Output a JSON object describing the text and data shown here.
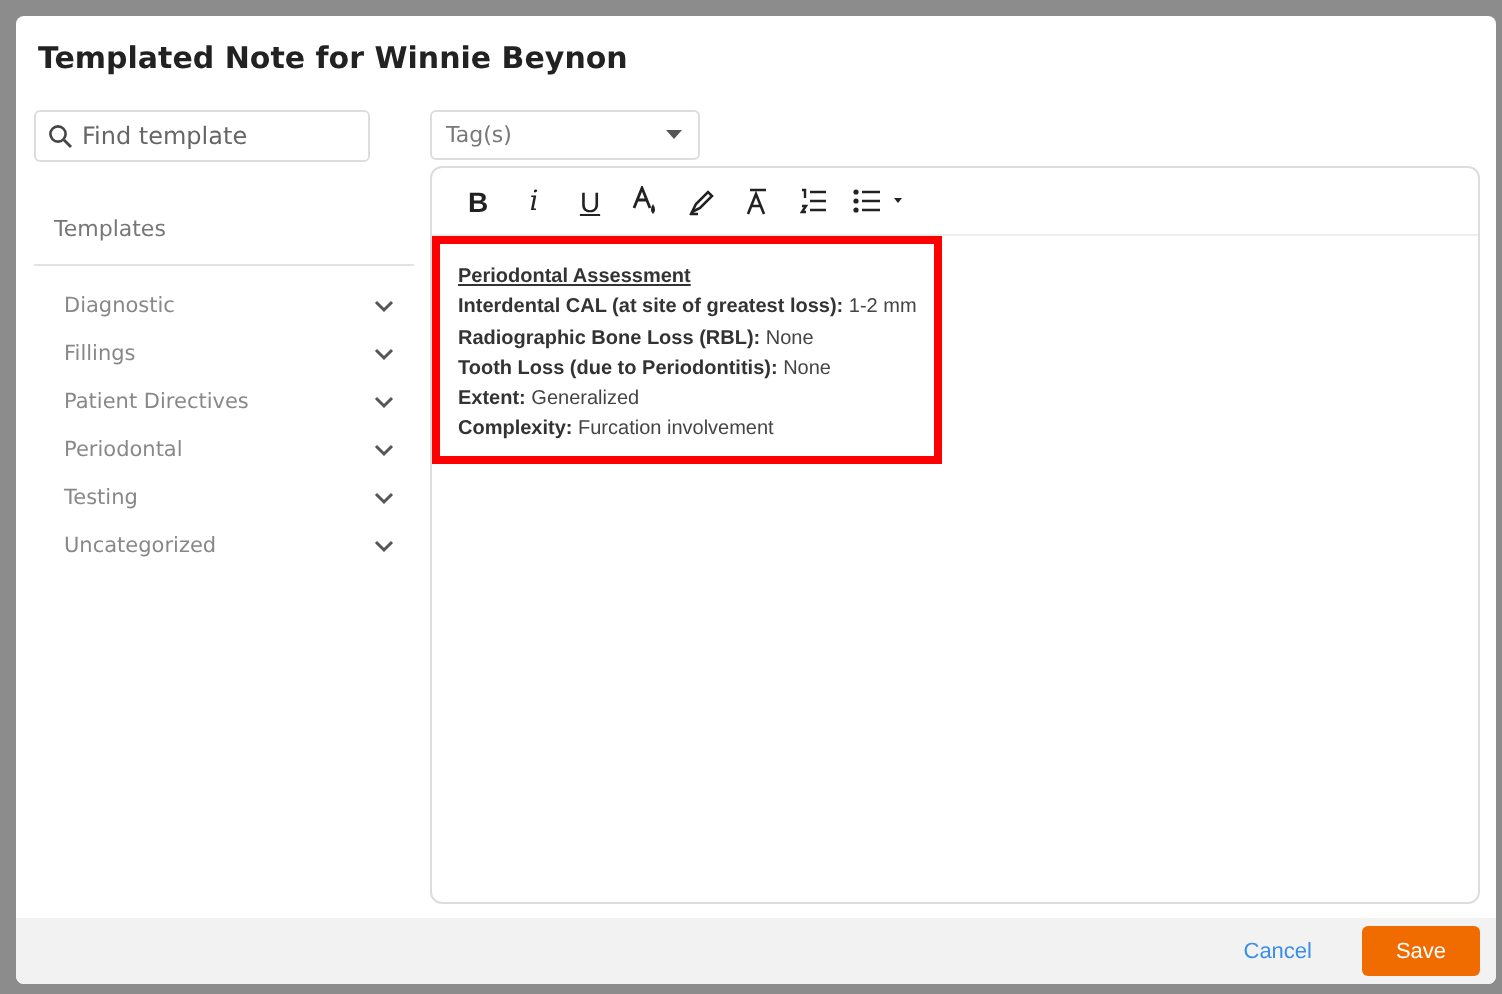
{
  "dialog": {
    "title": "Templated Note for Winnie Beynon"
  },
  "search": {
    "placeholder": "Find template"
  },
  "templates": {
    "heading": "Templates",
    "items": [
      {
        "label": "Diagnostic",
        "expanded": false
      },
      {
        "label": "Fillings",
        "expanded": false
      },
      {
        "label": "Patient Directives",
        "expanded": false
      },
      {
        "label": "Periodontal",
        "expanded": false
      },
      {
        "label": "Testing",
        "expanded": false
      },
      {
        "label": "Uncategorized",
        "expanded": false
      }
    ]
  },
  "tags": {
    "placeholder": "Tag(s)"
  },
  "toolbar": [
    {
      "kind": "bold",
      "label": "B"
    },
    {
      "kind": "italic",
      "label": "i"
    },
    {
      "kind": "underline",
      "label": "U"
    },
    {
      "kind": "font-color"
    },
    {
      "kind": "highlighter"
    },
    {
      "kind": "clear-format"
    },
    {
      "kind": "numbered-list"
    },
    {
      "kind": "bullet-list"
    }
  ],
  "note": {
    "highlighted": true,
    "lines": [
      {
        "kind": "heading",
        "text": "Periodontal Assessment"
      },
      {
        "kind": "field",
        "text": "**Interdental CAL (at site of greatest loss):** 1-2 mm"
      },
      {
        "kind": "field",
        "text": "**Radiographic Bone Loss (RBL):** None"
      },
      {
        "kind": "field",
        "text": "**Tooth Loss (due to Periodontitis):** None"
      },
      {
        "kind": "field",
        "text": "**Extent:** Generalized"
      },
      {
        "kind": "field",
        "text": "**Complexity:** Furcation involvement"
      }
    ]
  },
  "buttons": [
    {
      "kind": "link",
      "label": "Cancel"
    },
    {
      "kind": "primary",
      "label": "Save"
    }
  ]
}
